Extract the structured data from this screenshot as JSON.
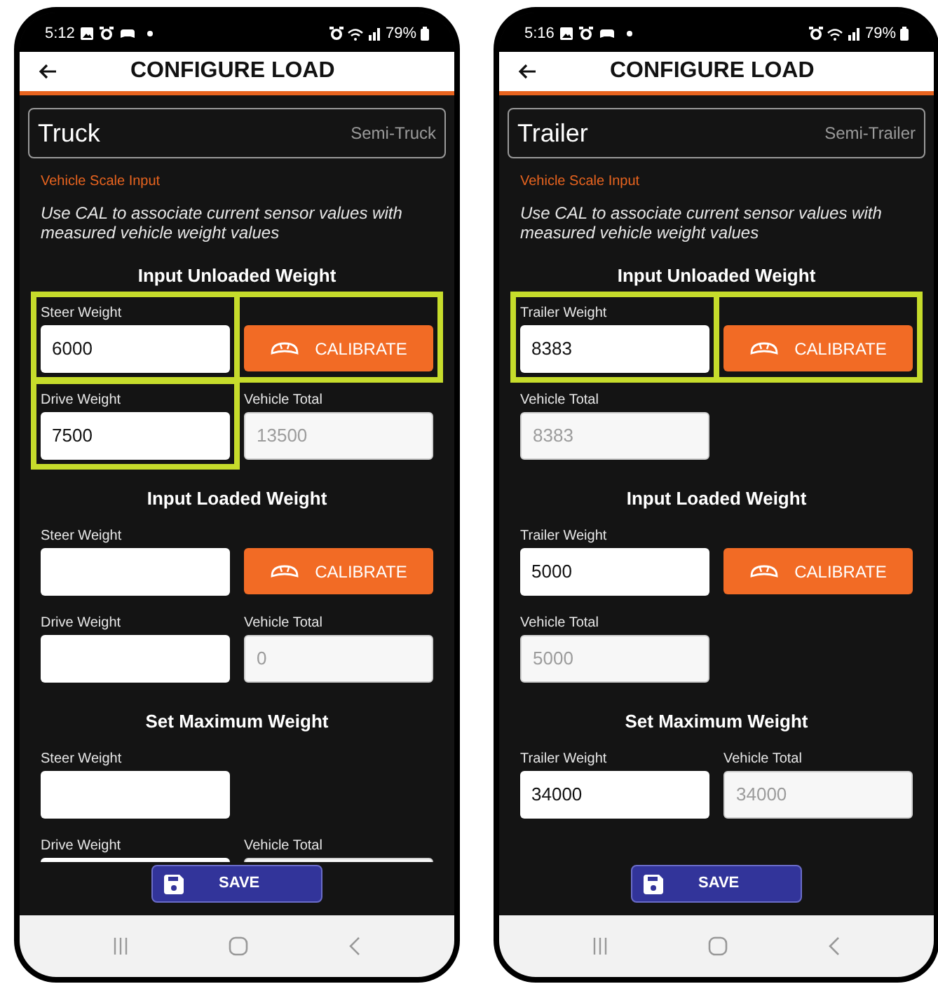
{
  "phones": [
    {
      "status_bar": {
        "time": "5:12",
        "battery": "79%"
      },
      "header": {
        "title": "CONFIGURE LOAD"
      },
      "vehicle": {
        "name": "Truck",
        "type": "Semi-Truck"
      },
      "section_label": "Vehicle Scale Input",
      "description": "Use CAL to associate current sensor values with measured vehicle weight values",
      "sections": [
        {
          "heading": "Input Unloaded Weight",
          "rows": [
            [
              {
                "kind": "field",
                "label": "Steer Weight",
                "value": "6000",
                "disabled": false,
                "highlighted": true
              },
              {
                "kind": "button",
                "label": "CALIBRATE",
                "highlighted": true
              }
            ],
            [
              {
                "kind": "field",
                "label": "Drive Weight",
                "value": "7500",
                "disabled": false,
                "highlighted": true
              },
              {
                "kind": "field",
                "label": "Vehicle Total",
                "value": "13500",
                "disabled": true,
                "highlighted": false
              }
            ]
          ]
        },
        {
          "heading": "Input Loaded Weight",
          "rows": [
            [
              {
                "kind": "field",
                "label": "Steer Weight",
                "disabled": false,
                "highlighted": false
              },
              {
                "kind": "button",
                "label": "CALIBRATE",
                "highlighted": false
              }
            ],
            [
              {
                "kind": "field",
                "label": "Drive Weight",
                "disabled": false,
                "highlighted": false
              },
              {
                "kind": "field",
                "label": "Vehicle Total",
                "value": "0",
                "disabled": true,
                "highlighted": false
              }
            ]
          ]
        },
        {
          "heading": "Set Maximum Weight",
          "rows": [
            [
              {
                "kind": "field",
                "label": "Steer Weight",
                "disabled": false,
                "highlighted": false
              },
              {
                "kind": "empty"
              }
            ],
            [
              {
                "kind": "field",
                "label": "Drive Weight",
                "disabled": false,
                "highlighted": false
              },
              {
                "kind": "field",
                "label": "Vehicle Total",
                "disabled": true,
                "highlighted": false
              }
            ]
          ]
        }
      ],
      "save_button": "SAVE"
    },
    {
      "status_bar": {
        "time": "5:16",
        "battery": "79%"
      },
      "header": {
        "title": "CONFIGURE LOAD"
      },
      "vehicle": {
        "name": "Trailer",
        "type": "Semi-Trailer"
      },
      "section_label": "Vehicle Scale Input",
      "description": "Use CAL to associate current sensor values with measured vehicle weight values",
      "sections": [
        {
          "heading": "Input Unloaded Weight",
          "rows": [
            [
              {
                "kind": "field",
                "label": "Trailer Weight",
                "value": "8383",
                "disabled": false,
                "highlighted": true
              },
              {
                "kind": "button",
                "label": "CALIBRATE",
                "highlighted": true
              }
            ],
            [
              {
                "kind": "field",
                "label": "Vehicle Total",
                "value": "8383",
                "disabled": true,
                "highlighted": false
              },
              {
                "kind": "empty"
              }
            ]
          ]
        },
        {
          "heading": "Input Loaded Weight",
          "rows": [
            [
              {
                "kind": "field",
                "label": "Trailer Weight",
                "value": "5000",
                "disabled": false,
                "highlighted": false
              },
              {
                "kind": "button",
                "label": "CALIBRATE",
                "highlighted": false
              }
            ],
            [
              {
                "kind": "field",
                "label": "Vehicle Total",
                "value": "5000",
                "disabled": true,
                "highlighted": false
              },
              {
                "kind": "empty"
              }
            ]
          ]
        },
        {
          "heading": "Set Maximum Weight",
          "rows": [
            [
              {
                "kind": "field",
                "label": "Trailer Weight",
                "value": "34000",
                "disabled": false,
                "highlighted": false
              },
              {
                "kind": "field",
                "label": "Vehicle Total",
                "value": "34000",
                "disabled": true,
                "highlighted": false
              }
            ]
          ]
        }
      ],
      "save_button": "SAVE"
    }
  ]
}
